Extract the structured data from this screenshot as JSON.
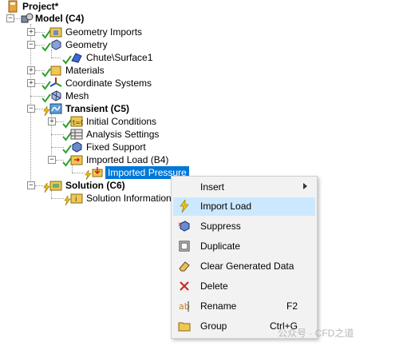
{
  "tree": {
    "project": "Project*",
    "model": "Model (C4)",
    "geometry_imports": "Geometry Imports",
    "geometry": "Geometry",
    "chute_surface": "Chute\\Surface1",
    "materials": "Materials",
    "coordinate_systems": "Coordinate Systems",
    "mesh": "Mesh",
    "transient": "Transient (C5)",
    "initial_conditions": "Initial Conditions",
    "analysis_settings": "Analysis Settings",
    "fixed_support": "Fixed Support",
    "imported_load": "Imported Load (B4)",
    "imported_pressure": "Imported Pressure",
    "solution": "Solution (C6)",
    "solution_information": "Solution Information"
  },
  "menu": {
    "insert": "Insert",
    "import_load": "Import Load",
    "suppress": "Suppress",
    "duplicate": "Duplicate",
    "clear_generated_data": "Clear Generated Data",
    "delete": "Delete",
    "rename": "Rename",
    "rename_shortcut": "F2",
    "group": "Group",
    "group_shortcut": "Ctrl+G"
  },
  "watermark": "公众号 · CFD之道",
  "colors": {
    "selection": "#0078d7",
    "menu_highlight": "#cce8ff",
    "check_green": "#2e9e2e",
    "lightning_yellow": "#f2c200"
  }
}
